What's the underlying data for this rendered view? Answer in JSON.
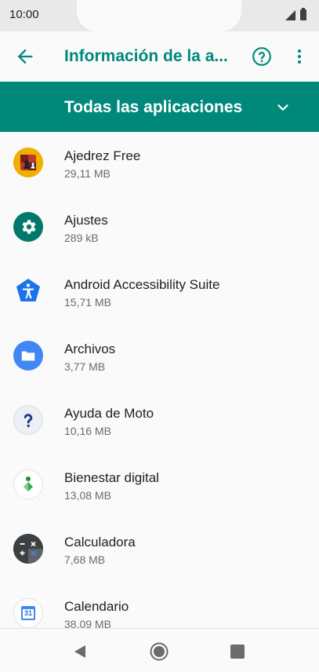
{
  "status_bar": {
    "time": "10:00"
  },
  "app_bar": {
    "title": "Información de la a..."
  },
  "filter": {
    "label": "Todas las aplicaciones"
  },
  "apps": [
    {
      "name": "Ajedrez Free",
      "size": "29,11 MB",
      "icon": "chess-icon"
    },
    {
      "name": "Ajustes",
      "size": "289 kB",
      "icon": "settings-gear-icon"
    },
    {
      "name": "Android Accessibility Suite",
      "size": "15,71 MB",
      "icon": "accessibility-icon"
    },
    {
      "name": "Archivos",
      "size": "3,77 MB",
      "icon": "folder-icon"
    },
    {
      "name": "Ayuda de Moto",
      "size": "10,16 MB",
      "icon": "question-mark-icon"
    },
    {
      "name": "Bienestar digital",
      "size": "13,08 MB",
      "icon": "digital-wellbeing-icon"
    },
    {
      "name": "Calculadora",
      "size": "7,68 MB",
      "icon": "calculator-icon"
    },
    {
      "name": "Calendario",
      "size": "38,09 MB",
      "icon": "calendar-icon",
      "day": "31"
    }
  ],
  "colors": {
    "accent": "#00897b",
    "background": "#fafafa"
  }
}
